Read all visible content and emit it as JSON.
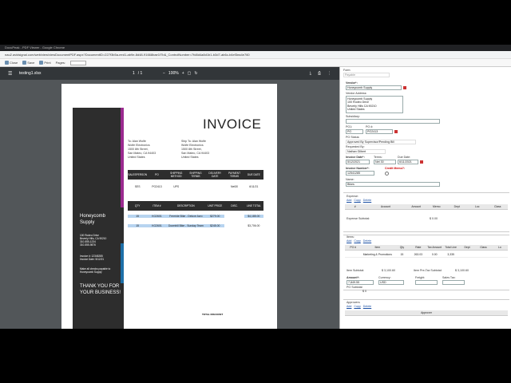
{
  "browser": {
    "title": "DocuPeak - PDF Viewer - Google Chrome",
    "url": "nau2.avidsignal.com/web/view/viewDocumentPDF.aspx?DocumentID=227f3b5a-eed1-ab9e-8d48-91668bae1f7b&_ControlNumber=7fd8d4a8d1b1-b3d7-ab6c-b4ef3ea4e760"
  },
  "toolbar": {
    "close_label": "Close",
    "save_label": "Save",
    "print_label": "Print",
    "pages_label": "Pages:"
  },
  "pdf": {
    "filename": "testing1.xlsx",
    "page_current": "1",
    "page_total": "/ 1",
    "zoom": "100%",
    "invoice_title": "INVOICE",
    "vendor_name": "Honeycomb Supply",
    "vendor_address": [
      "100 Rodeo Drive",
      "Beverly Hills, CA 90210",
      "310-555-1234",
      "310-555-9876"
    ],
    "invoice_no": "Invoice #: 12345285",
    "invoice_date": "Invoice Date: 5/12/21",
    "checks_note": "Make all checks payable to Honeycomb Supply",
    "thanks": "THANK YOU FOR YOUR BUSINESS!",
    "to_address": [
      "To: Alan Wolfe",
      "Wolfe Electronics",
      "1500 8th Street,",
      "San Mateo, CA 94403",
      "United States"
    ],
    "ship_address": [
      "Ship To: Alan Wolfe",
      "Wolfe Electronics",
      "1500 8th Street,",
      "San Mateo, CA 94403",
      "United States"
    ],
    "head1": [
      "SALESPERSON",
      "PO",
      "SHIPPING METHOD",
      "SHIPPING TERMS",
      "DELIVERY DATE",
      "PAYMENT TERMS",
      "DUE DATE"
    ],
    "row1": [
      "SES",
      "PO2413",
      "UPS",
      "",
      "",
      "Net30",
      "6/11/21"
    ],
    "head2": [
      "QTY",
      "ITEM #",
      "DESCRIPTION",
      "UNIT PRICE",
      "DISC.",
      "LINE TOTAL"
    ],
    "items": [
      [
        "15",
        "KG2601",
        "Freeride Bike - Deluxe Acro",
        "$279.00",
        "",
        "$4,185.00"
      ],
      [
        "15",
        "KG2601",
        "Downhill Bike - Sunday Team",
        "$245.00",
        "",
        "$3,706.00"
      ]
    ],
    "total_label": "TOTAL DISCOUNT"
  },
  "form": {
    "form_label": "Form:",
    "form_value": "Payable",
    "vendor_label": "Vendor*:",
    "vendor_value": "Honeycomb Supply",
    "vendor_address_label": "Vendor Address:",
    "vendor_address_lines": [
      "Honeycomb Supply",
      "100 Rodeo Drive",
      "Beverly Hills CA 90210",
      "United States"
    ],
    "subsidiary_label": "Subsidiary:",
    "po1_label": "PO1:",
    "po1_value": "PO",
    "po_no_label": "PO #:",
    "po_no_value": "PO2413",
    "po_status_label": "PO Status:",
    "po_status_value": "Approved By Supervisor/Pending Bill",
    "requested_by_label": "Requested By:",
    "requested_by_value": "Nathan Gilbert",
    "invoice_date_label": "Invoice Date*:",
    "invoice_date_value": "5/12/2021",
    "terms_label": "Terms:",
    "terms_value": "Net 30",
    "due_date_label": "Due Date:",
    "due_date_value": "6/11/2021",
    "invoice_no_label": "Invoice Number*:",
    "invoice_no_value": "12541285",
    "credit_memo_label": "Credit Memo?:",
    "name_label": "Name:",
    "name_value": "Bikes",
    "expense_label": "Expense:",
    "add_label": "Add",
    "copy_label": "Copy",
    "delete_label": "Delete",
    "expense_cols": [
      "#",
      "Account",
      "Amount",
      "Memo",
      "Dept",
      "Loc",
      "Class"
    ],
    "expense_subtotal_label": "Expense Subtotal:",
    "expense_subtotal_value": "$ 0.00",
    "items_label": "Items:",
    "items_cols": [
      "PO #",
      "Item",
      "Qty",
      "Rate",
      "Tax Amount",
      "Total Line",
      "Dept",
      "Class",
      "Lo"
    ],
    "items_row": [
      "",
      "Marketing & Promotions",
      "15",
      "263.03",
      "0.00",
      "3,335",
      "",
      "",
      ""
    ],
    "item_subtotal_label": "Item Subtotal:",
    "item_subtotal_value": "$ 3,100.60",
    "item_pretax_label": "Item Pre-Tax Subtotal:",
    "item_pretax_value": "$ 3,100.60",
    "amount_label": "Amount*:",
    "amount_value": "7,849.55",
    "currency_label": "Currency:",
    "currency_value": "USD",
    "freight_label": "Freight:",
    "sales_tax_label": "Sales Tax:",
    "po_subtotal_label": "PO Subtotal:",
    "po_subtotal_value": "$ 0",
    "approvers_label": "Approvers:",
    "approver_col": "Approver"
  }
}
